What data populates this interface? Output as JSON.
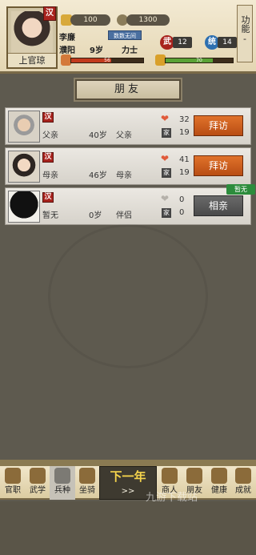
{
  "header": {
    "character_name": "上官琼",
    "nation_badge": "汉",
    "gold": "100",
    "coins": "1300",
    "master": "李廉",
    "location": "濮阳",
    "age": "9岁",
    "occupation": "力士",
    "tag": "数数无间",
    "stat_martial_label": "武",
    "stat_martial_value": "12",
    "stat_command_label": "统",
    "stat_command_value": "14",
    "bar_health_value": "56",
    "bar_health_fraction": 0.56,
    "bar_mood_value": "70",
    "bar_mood_fraction": 0.7,
    "function_label": "功能",
    "function_arrow": "-"
  },
  "page_title": "朋友",
  "friends": [
    {
      "nation": "汉",
      "name": "父亲",
      "age": "40岁",
      "relation": "父亲",
      "affection": "32",
      "clan": "19",
      "action": "拜访",
      "action_style": "orange"
    },
    {
      "nation": "汉",
      "name": "母亲",
      "age": "46岁",
      "relation": "母亲",
      "affection": "41",
      "clan": "19",
      "action": "拜访",
      "action_style": "orange"
    },
    {
      "nation": "汉",
      "name": "暂无",
      "age": "0岁",
      "relation": "伴侣",
      "affection": "0",
      "clan": "0",
      "action": "相亲",
      "action_style": "gray"
    }
  ],
  "none_tag": "暂无",
  "clan_glyph": "家",
  "nav": {
    "items": [
      "官职",
      "武学",
      "兵种",
      "坐骑",
      "商人",
      "朋友",
      "健康",
      "成就"
    ],
    "active_index": 2,
    "next_year_label": "下一年",
    "next_year_arrow": ">>"
  },
  "watermark": "九游下载站",
  "colors": {
    "accent_orange": "#c85a1c",
    "nation_red": "#a8231d",
    "health_bar": "#c23a1c",
    "mood_bar": "#5aa236"
  }
}
